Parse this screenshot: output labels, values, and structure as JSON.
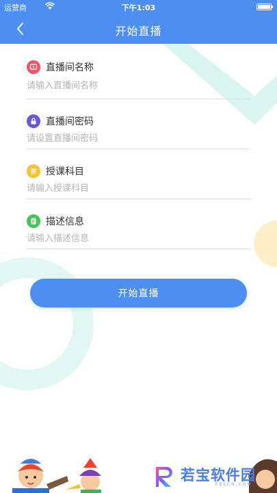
{
  "status_bar": {
    "carrier": "运营商",
    "time": "下午1:03",
    "icons": [
      "wifi-icon",
      "battery-icon"
    ]
  },
  "nav": {
    "title": "开始直播",
    "back_icon": "chevron-left-icon"
  },
  "form": {
    "fields": [
      {
        "label": "直播间名称",
        "placeholder": "请输入直播间名称",
        "value": "",
        "icon": "live-room-icon",
        "icon_color": "#ef5466"
      },
      {
        "label": "直播间密码",
        "placeholder": "请设置直播间密码",
        "value": "",
        "icon": "lock-icon",
        "icon_color": "#6a59d6"
      },
      {
        "label": "授课科目",
        "placeholder": "请输入授课科目",
        "value": "",
        "icon": "subject-list-icon",
        "icon_color": "#f5c435"
      },
      {
        "label": "描述信息",
        "placeholder": "请输入描述信息",
        "value": "",
        "icon": "document-icon",
        "icon_color": "#45c35c"
      }
    ]
  },
  "start_button": {
    "label": "开始直播"
  },
  "watermark": {
    "text": "若宝软件园",
    "sub": "RBSCN.COM"
  },
  "colors": {
    "primary": "#4d8ff0",
    "deco_teal": "#d8f5ee",
    "deco_yellow": "#fdf0c8"
  }
}
